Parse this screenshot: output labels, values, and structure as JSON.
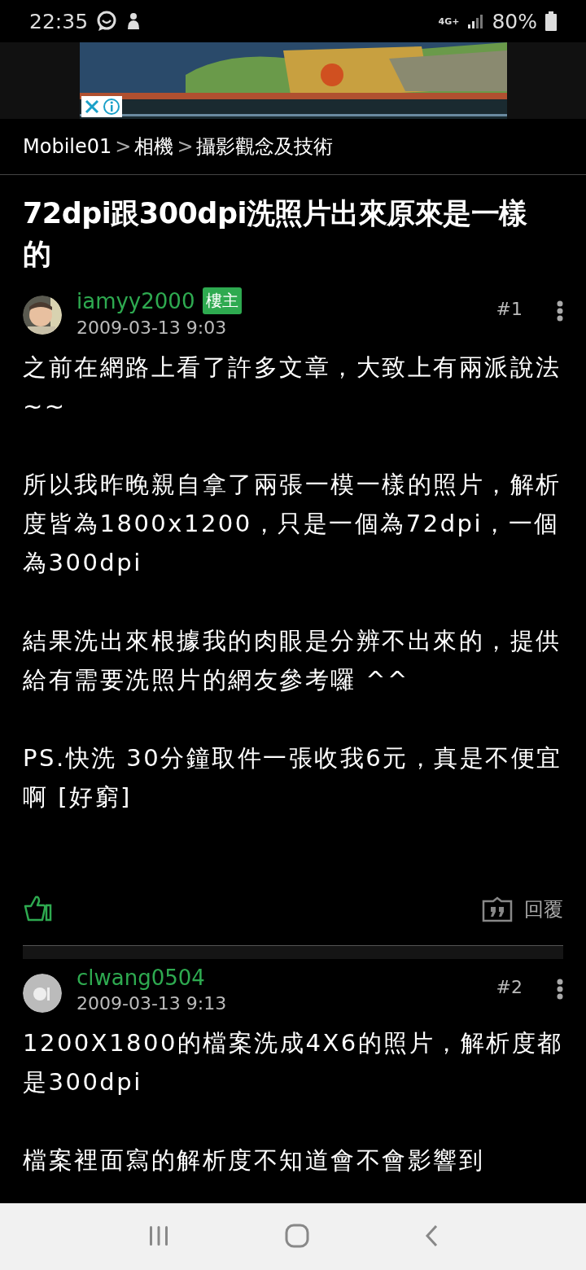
{
  "status_bar": {
    "time": "22:35",
    "network": "4G+",
    "battery": "80%"
  },
  "breadcrumb": {
    "separator": ">",
    "items": [
      "Mobile01",
      "相機",
      "攝影觀念及技術"
    ]
  },
  "title": "72dpi跟300dpi洗照片出來原來是一樣的",
  "posts": [
    {
      "author": "iamyy2000",
      "badge": "樓主",
      "date": "2009-03-13 9:03",
      "floor": "#1",
      "paragraphs": [
        "之前在網路上看了許多文章，大致上有兩派說法~~",
        "所以我昨晚親自拿了兩張一模一樣的照片，解析度皆為1800x1200，只是一個為72dpi，一個為300dpi",
        "結果洗出來根據我的肉眼是分辨不出來的，提供給有需要洗照片的網友參考囉 ^^",
        "PS.快洗 30分鐘取件一張收我6元，真是不便宜啊 [好窮]"
      ],
      "reply": "回覆"
    },
    {
      "author": "clwang0504",
      "date": "2009-03-13 9:13",
      "floor": "#2",
      "avatar": {
        "kind": "default"
      },
      "paragraphs": [
        "1200X1800的檔案洗成4X6的照片，解析度都是300dpi",
        "檔案裡面寫的解析度不知道會不會影響到"
      ]
    }
  ]
}
